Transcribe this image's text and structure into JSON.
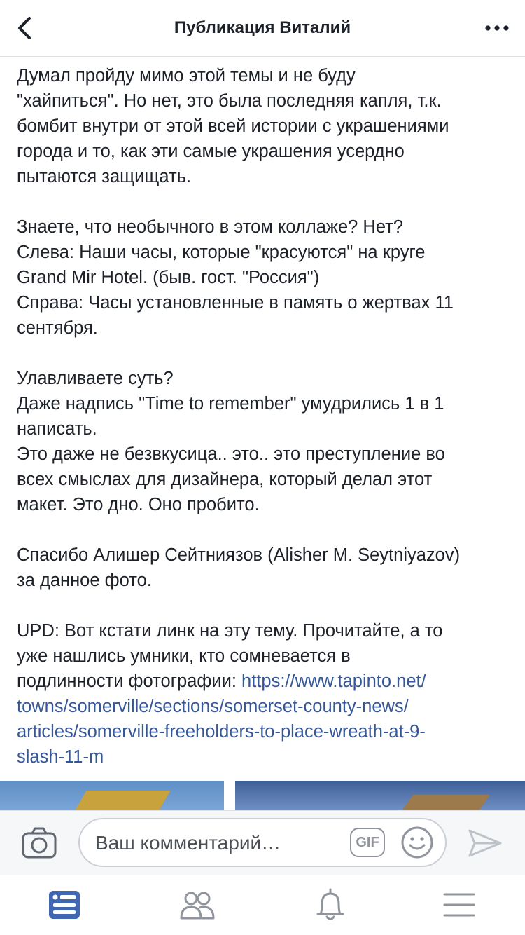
{
  "header": {
    "title": "Публикация Виталий",
    "back_icon": "chevron-left-icon",
    "more_icon": "more-dots-icon"
  },
  "post": {
    "paragraphs": [
      [
        "Думал пройду мимо этой темы и не буду",
        "\"хайпиться\". Но нет, это была последняя капля, т.к.",
        "бомбит внутри от этой всей истории с украшениями",
        "города и то, как эти самые украшения усердно",
        "пытаются защищать."
      ],
      [
        "Знаете, что необычного в этом коллаже? Нет?",
        "Слева: Наши часы, которые \"красуются\" на круге",
        "Grand Mir Hotel. (быв. гост. \"Россия\")",
        "Справа: Часы установленные в память о жертвах 11",
        "сентября."
      ],
      [
        "Улавливаете суть?",
        "Даже надпись \"Time to remember\" умудрились 1 в 1",
        "написать.",
        "Это даже не безвкусица.. это.. это преступление во",
        "всех смыслах для дизайнера, который делал этот",
        "макет. Это дно. Оно пробито."
      ],
      [
        "Спасибо Алишер Сейтниязов (Alisher M. Seytniyazov)",
        "за данное фото."
      ]
    ],
    "upd_lines": [
      "UPD: Вот кстати линк на эту тему. Прочитайте, а то",
      "уже нашлись умники, кто сомневается в"
    ],
    "upd_prefix": "подлинности фотографии: ",
    "link_lines": [
      "https://www.tapinto.net/",
      "towns/somerville/sections/somerset-county-news/",
      "articles/somerville-freeholders-to-place-wreath-at-9-",
      "slash-11-m"
    ],
    "link_color": "#365899"
  },
  "comment_bar": {
    "placeholder": "Ваш комментарий…",
    "gif_label": "GIF",
    "icons": [
      "camera-icon",
      "gif-icon",
      "smiley-icon",
      "send-icon"
    ]
  },
  "tabbar": {
    "icons": [
      "news-feed-icon",
      "friends-icon",
      "notifications-bell-icon",
      "menu-icon"
    ],
    "active_color": "#4267b2",
    "inactive_color": "#90949c"
  }
}
